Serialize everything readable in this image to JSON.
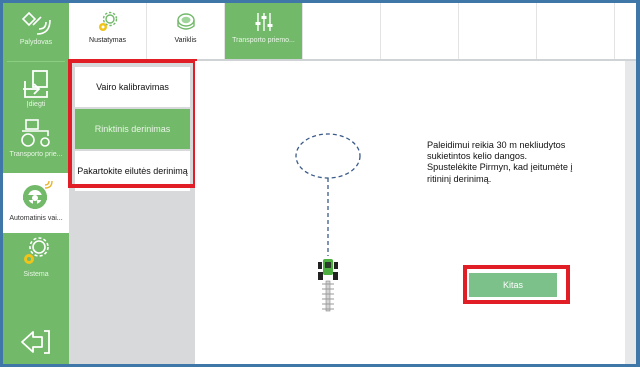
{
  "sidebar": {
    "items": [
      {
        "label": "Palydovas",
        "icon": "satellite-icon"
      },
      {
        "label": "Įdiegti",
        "icon": "install-icon"
      },
      {
        "label": "Transporto prie...",
        "icon": "tractor-icon"
      },
      {
        "label": "Automatinis vai...",
        "icon": "steering-wheel-icon"
      },
      {
        "label": "Sistema",
        "icon": "gear-icon"
      }
    ],
    "back_icon": "back-arrow-icon"
  },
  "tabs": [
    {
      "label": "Nustatymas",
      "icon": "gear-icon"
    },
    {
      "label": "Variklis",
      "icon": "motor-icon"
    },
    {
      "label": "Transporto priemo...",
      "icon": "sliders-icon"
    }
  ],
  "submenu": [
    {
      "label": "Vairo kalibravimas"
    },
    {
      "label": "Rinktinis derinimas"
    },
    {
      "label": "Pakartokite eilutės derinimą"
    }
  ],
  "instruction": {
    "line1": "Paleidimui reikia 30 m nekliudytos",
    "line2": "sukietintos kelio dangos.",
    "line3": "Spustelėkite Pirmyn, kad įeitumėte į",
    "line4": "ritininį derinimą."
  },
  "next_button": "Kitas",
  "colors": {
    "accent_green": "#72b96a",
    "button_green": "#7cc08a",
    "highlight_red": "#e11d25",
    "page_border_blue": "#3f78a8"
  }
}
